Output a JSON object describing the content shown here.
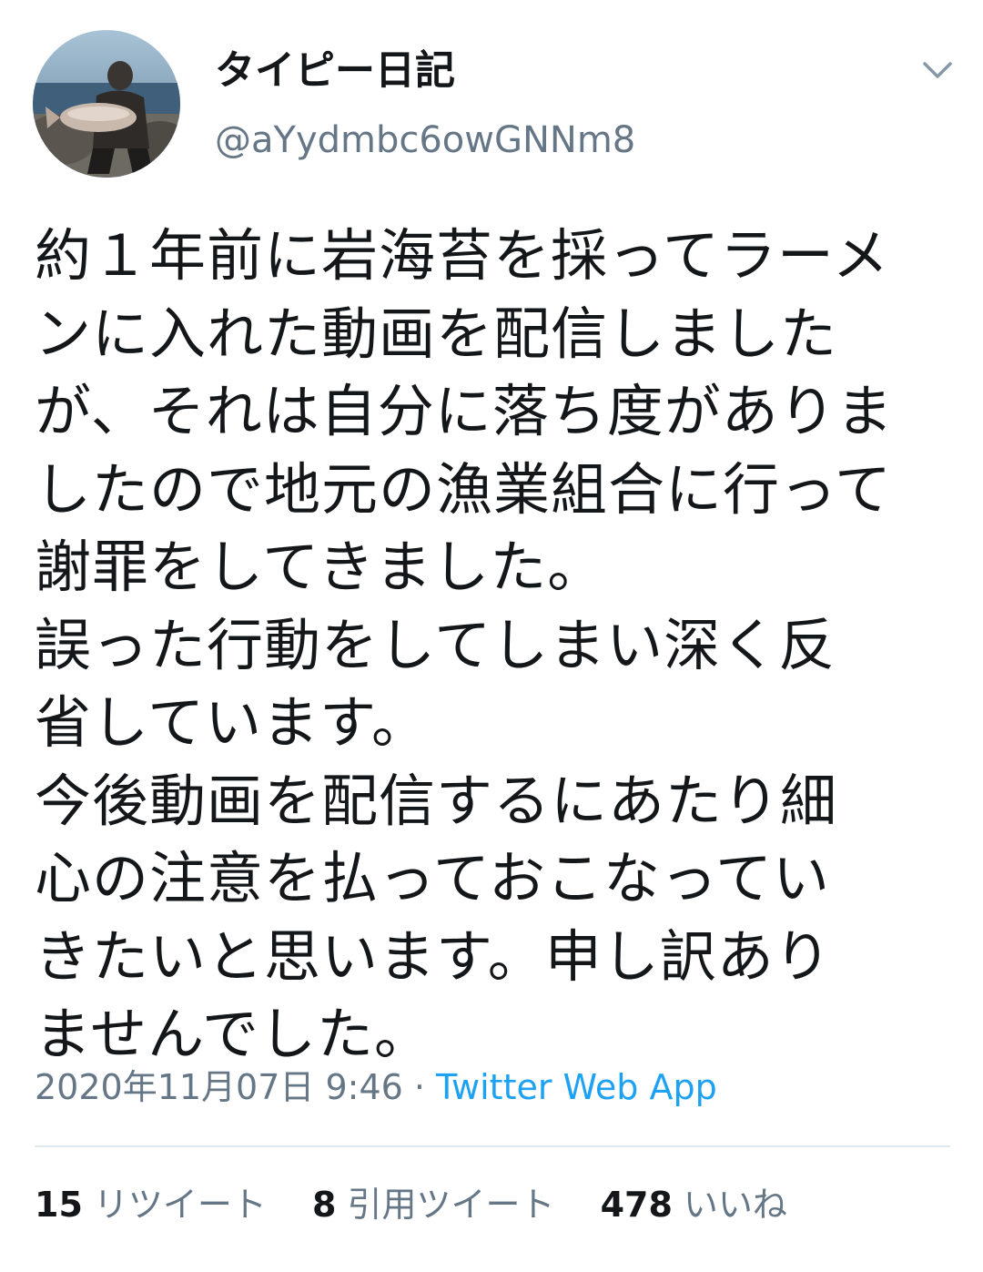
{
  "author": {
    "display_name": "タイピー日記",
    "handle": "@aYydmbc6owGNNm8"
  },
  "tweet": {
    "lines": [
      "約１年前に岩海苔を採ってラーメ",
      "ンに入れた動画を配信しました",
      "が、それは自分に落ち度がありま",
      "したので地元の漁業組合に行って",
      "謝罪をしてきました。",
      "誤った行動をしてしまい深く反",
      "省しています。",
      "今後動画を配信するにあたり細",
      "心の注意を払っておこなってい",
      "きたいと思います。申し訳あり",
      "ませんでした。"
    ],
    "timestamp": "2020年11月07日 9:46",
    "separator": "·",
    "source": "Twitter Web App"
  },
  "stats": {
    "retweets_count": "15",
    "retweets_label": "リツイート",
    "quotes_count": "8",
    "quotes_label": "引用ツイート",
    "likes_count": "478",
    "likes_label": "いいね"
  },
  "icons": {
    "menu": "chevron-down-icon"
  },
  "colors": {
    "text": "#14171a",
    "secondary": "#657786",
    "link": "#1da1f2",
    "divider": "#e1e8ed"
  }
}
